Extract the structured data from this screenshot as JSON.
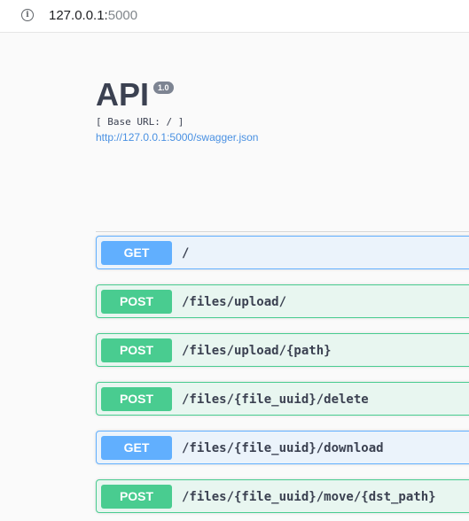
{
  "browser": {
    "url_host": "127.0.0.1:",
    "url_port": "5000"
  },
  "info": {
    "title": "API",
    "version": "1.0",
    "base_url": "[ Base URL: / ]",
    "spec_link": "http://127.0.0.1:5000/swagger.json"
  },
  "operations": [
    {
      "method": "GET",
      "path": "/"
    },
    {
      "method": "POST",
      "path": "/files/upload/"
    },
    {
      "method": "POST",
      "path": "/files/upload/{path}"
    },
    {
      "method": "POST",
      "path": "/files/{file_uuid}/delete"
    },
    {
      "method": "GET",
      "path": "/files/{file_uuid}/download"
    },
    {
      "method": "POST",
      "path": "/files/{file_uuid}/move/{dst_path}"
    }
  ],
  "colors": {
    "get": "#61affe",
    "post": "#49cc90",
    "link": "#4990e2"
  }
}
